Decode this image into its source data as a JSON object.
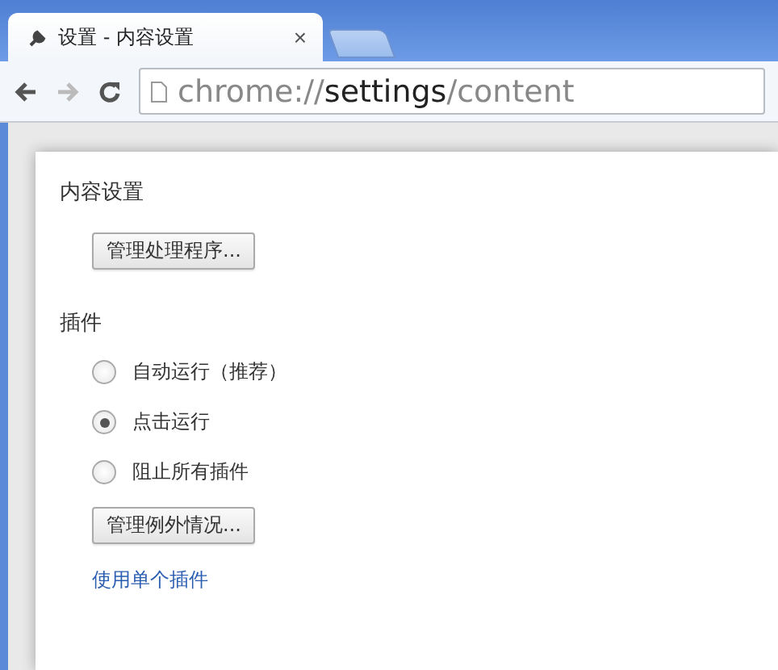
{
  "tab": {
    "title": "设置 - 内容设置",
    "close": "×"
  },
  "address": {
    "scheme": "chrome://",
    "host": "settings",
    "path": "/content"
  },
  "dialog": {
    "title": "内容设置",
    "handlers_button": "管理处理程序...",
    "section": "插件",
    "options": [
      {
        "label": "自动运行（推荐）",
        "selected": false
      },
      {
        "label": "点击运行",
        "selected": true
      },
      {
        "label": "阻止所有插件",
        "selected": false
      }
    ],
    "exceptions_button": "管理例外情况...",
    "link": "使用单个插件"
  }
}
